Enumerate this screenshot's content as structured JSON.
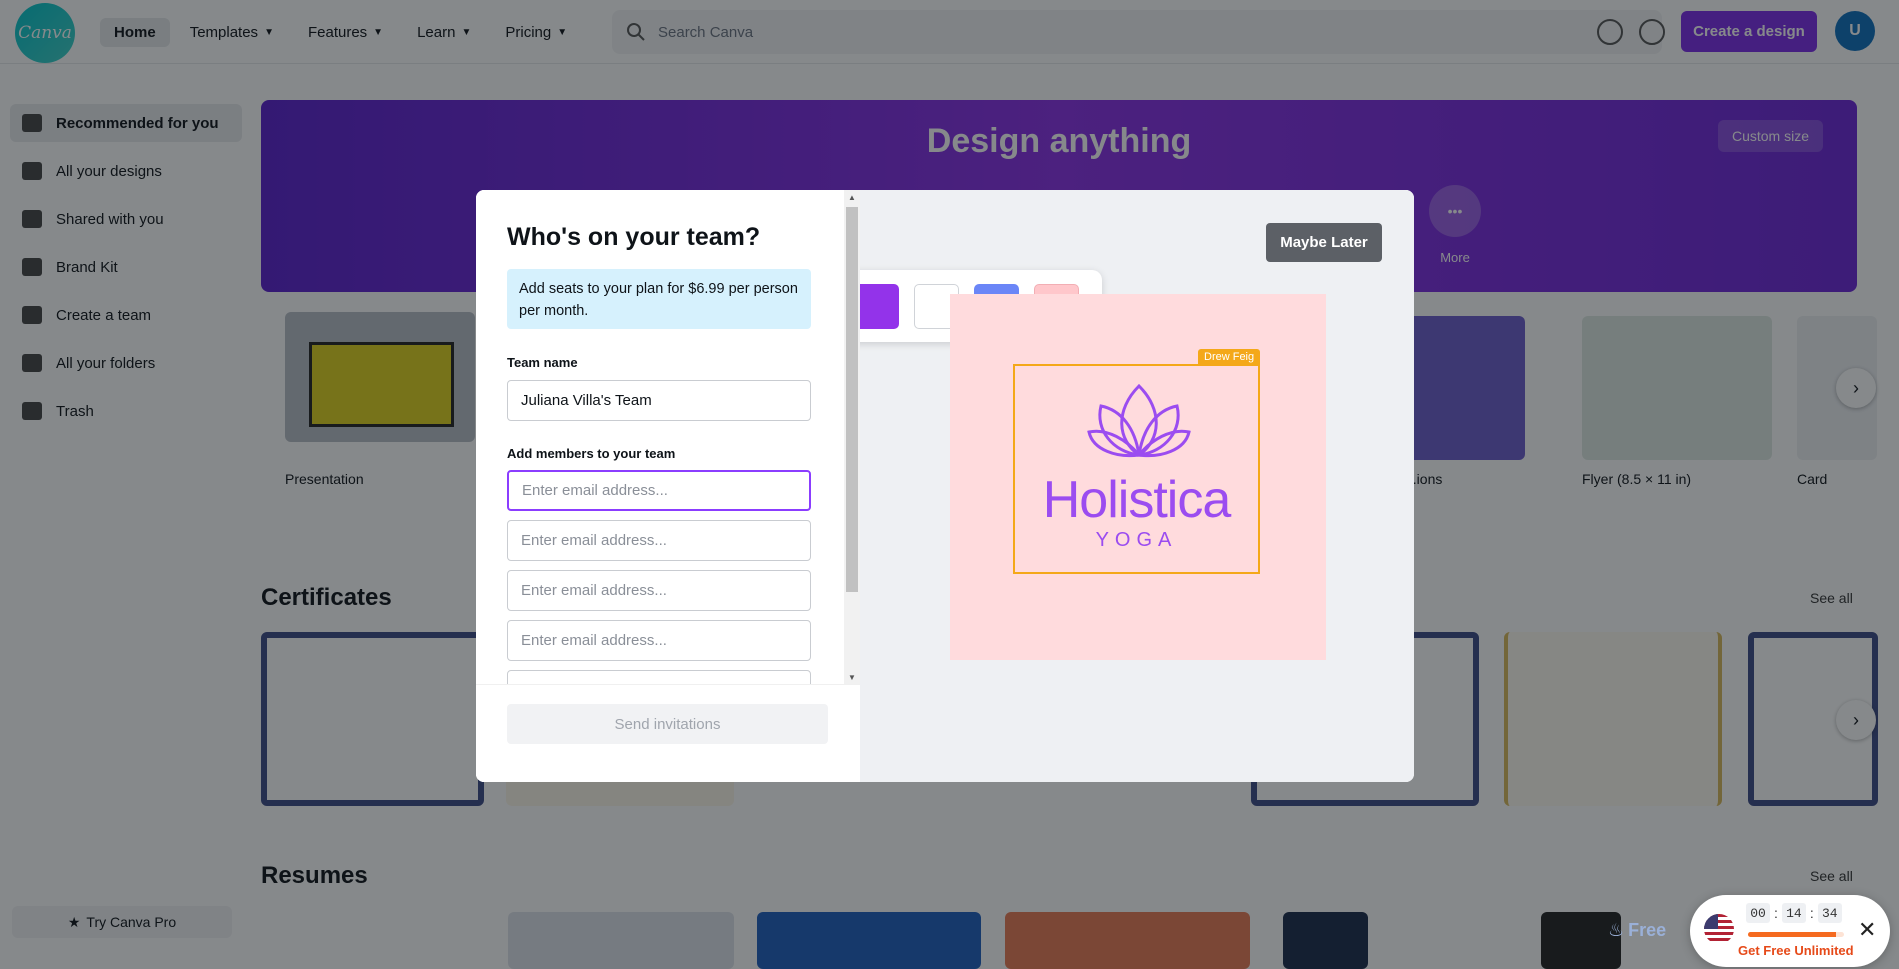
{
  "app": {
    "logo_text": "Canva",
    "nav": [
      {
        "label": "Home"
      },
      {
        "label": "Templates"
      },
      {
        "label": "Features"
      },
      {
        "label": "Learn"
      },
      {
        "label": "Pricing"
      }
    ],
    "search_placeholder": "Search Canva",
    "create_button": "Create a design",
    "avatar_initial": "U"
  },
  "sidebar": {
    "items": [
      {
        "label": "Recommended for you",
        "icon": "home-icon"
      },
      {
        "label": "All your designs",
        "icon": "designs-icon"
      },
      {
        "label": "Shared with you",
        "icon": "shared-icon"
      },
      {
        "label": "Brand Kit",
        "icon": "brand-icon"
      },
      {
        "label": "Create a team",
        "icon": "team-icon"
      },
      {
        "label": "All your folders",
        "icon": "folder-icon"
      },
      {
        "label": "Trash",
        "icon": "trash-icon"
      }
    ],
    "try_pro": "Try Canva Pro"
  },
  "hero": {
    "title": "Design anything",
    "custom_size": "Custom size",
    "more_label": "More"
  },
  "recommended": {
    "items": [
      {
        "label": "Presentation"
      },
      {
        "label": "...ions"
      },
      {
        "label": "Flyer (8.5 × 11 in)"
      },
      {
        "label": "Card"
      }
    ]
  },
  "sections": {
    "certificates": {
      "title": "Certificates",
      "see_all": "See all"
    },
    "resumes": {
      "title": "Resumes",
      "see_all": "See all"
    }
  },
  "modal": {
    "title": "Who's on your team?",
    "info": "Add seats to your plan for $6.99 per person per month.",
    "team_name_label": "Team name",
    "team_name_value": "Juliana Villa's Team",
    "members_label": "Add members to your team",
    "email_placeholder": "Enter email address...",
    "send_button": "Send invitations",
    "maybe_later": "Maybe Later",
    "preview": {
      "owner_tag": "Drew Feig",
      "brand_name": "Holistica",
      "brand_sub": "YOGA",
      "accent_color": "#9b4cf0",
      "frame_color": "#f4a819",
      "background_color": "#ffdbdd",
      "swatches": [
        "#9333ea",
        "#ffffff",
        "#6b86f7",
        "#ffc7cb"
      ]
    }
  },
  "promo": {
    "timer": {
      "hours": "00",
      "minutes": "14",
      "seconds": "34"
    },
    "cta": "Get Free Unlimited",
    "free_badge": "Free",
    "progress": 0.92
  }
}
